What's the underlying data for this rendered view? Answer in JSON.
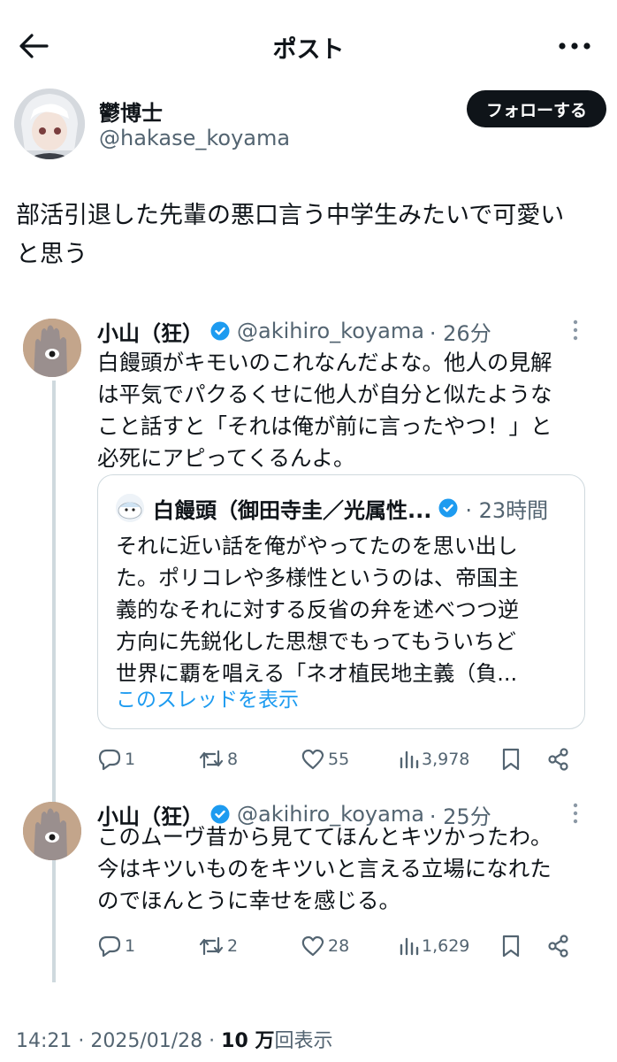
{
  "header": {
    "title": "ポスト"
  },
  "author": {
    "name": "鬱博士",
    "handle": "@hakase_koyama",
    "follow_label": "フォローする"
  },
  "post": {
    "lines": [
      "部活引退した先輩の悪口言う中学生みたいで可愛い",
      "と思う"
    ]
  },
  "replies": [
    {
      "name": "小山（狂）",
      "handle": "@akihiro_koyama",
      "time": "· 26分",
      "lines": [
        "白饅頭がキモいのこれなんだよな。他人の見解",
        "は平気でパクるくせに他人が自分と似たような",
        "こと話すと「それは俺が前に言ったやつ！」と",
        "必死にアピってくるんよ。"
      ],
      "quote": {
        "name": "白饅頭（御田寺圭／光属性...",
        "time": "· 23時間",
        "lines": [
          "それに近い話を俺がやってたのを思い出し",
          "た。ポリコレや多様性というのは、帝国主",
          "義的なそれに対する反省の弁を述べつつ逆",
          "方向に先鋭化した思想でもってもういちど",
          "世界に覇を唱える「ネオ植民地主義（負..."
        ],
        "link": "このスレッドを表示"
      },
      "stats": {
        "replies": "1",
        "reposts": "8",
        "likes": "55",
        "views": "3,978"
      }
    },
    {
      "name": "小山（狂）",
      "handle": "@akihiro_koyama",
      "time": "· 25分",
      "lines": [
        "このムーヴ昔から見ててほんとキツかったわ。",
        "今はキツいものをキツいと言える立場になれた",
        "のでほんとうに幸せを感じる。"
      ],
      "stats": {
        "replies": "1",
        "reposts": "2",
        "likes": "28",
        "views": "1,629"
      }
    }
  ],
  "footer": {
    "time": "14:21 · 2025/01/28 · ",
    "views_count": "10 万",
    "views_label": "回表示"
  },
  "colors": {
    "text": "#0f1419",
    "muted": "#536471",
    "link": "#1d9bf0",
    "verified": "#1d9bf0"
  }
}
